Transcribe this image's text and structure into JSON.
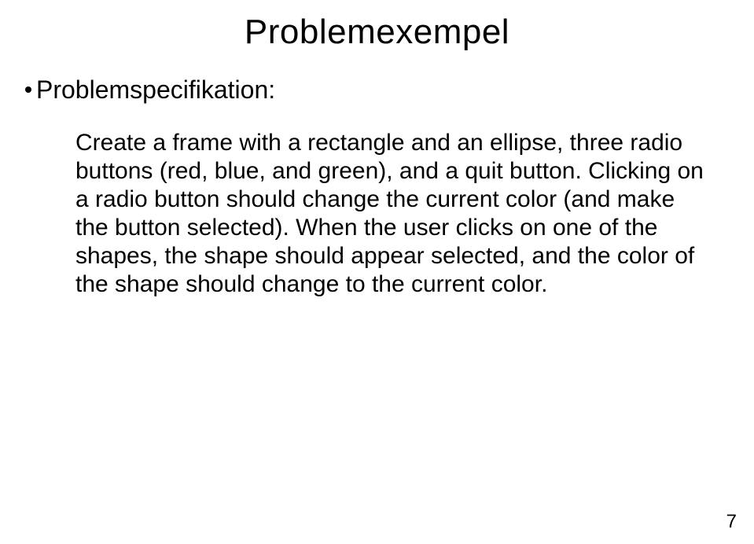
{
  "title": "Problemexempel",
  "bullet_label": "Problemspecifikation:",
  "body": "Create a frame with a rectangle and an ellipse, three radio buttons (red, blue, and green), and a quit button. Clicking on a radio button should change the current color (and make the button selected). When the user clicks on one of the shapes, the shape should appear selected, and the color of the shape should change to the current color.",
  "page_number": "7"
}
